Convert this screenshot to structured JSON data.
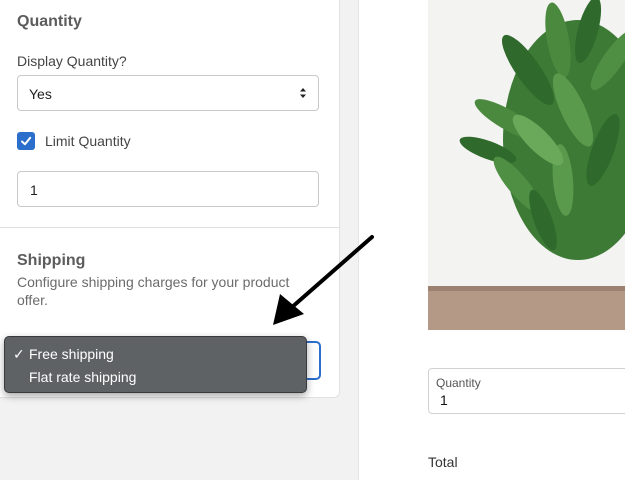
{
  "quantity_section": {
    "title": "Quantity",
    "display_label": "Display Quantity?",
    "display_value": "Yes",
    "limit_label": "Limit Quantity",
    "limit_checked": true,
    "limit_value": "1"
  },
  "shipping_section": {
    "title": "Shipping",
    "description": "Configure shipping charges for your product offer.",
    "options": [
      {
        "label": "Free shipping",
        "selected": true
      },
      {
        "label": "Flat rate shipping",
        "selected": false
      }
    ]
  },
  "preview": {
    "quantity_label": "Quantity",
    "quantity_value": "1",
    "total_label": "Total"
  },
  "colors": {
    "accent": "#2c6ecb",
    "dropdown_bg": "#5f6264"
  },
  "icons": {
    "checkbox": "checkmark-icon",
    "select": "chevron-updown-icon",
    "selected_option": "checkmark-icon",
    "annotation": "arrow-icon"
  }
}
